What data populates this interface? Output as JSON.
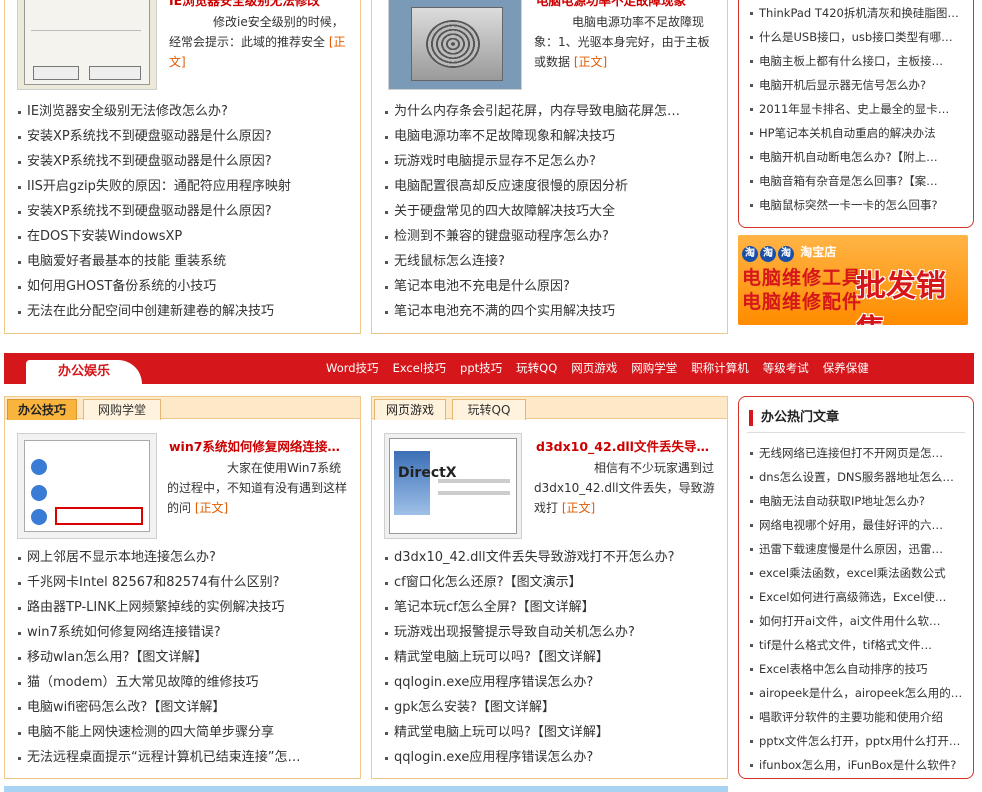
{
  "top_left": {
    "feature_title": "IE浏览器安全级别无法修改",
    "feature_text": "修改ie安全级别的时候，经常会提示：此域的推荐安全",
    "more_label": "[正文]",
    "list": [
      "IE浏览器安全级别无法修改怎么办?",
      "安装XP系统找不到硬盘驱动器是什么原因?",
      "安装XP系统找不到硬盘驱动器是什么原因?",
      "IIS开启gzip失败的原因：通配符应用程序映射",
      "安装XP系统找不到硬盘驱动器是什么原因?",
      "在DOS下安装WindowsXP",
      "电脑爱好者最基本的技能 重装系统",
      "如何用GHOST备份系统的小技巧",
      "无法在此分配空间中创建新建卷的解决技巧"
    ]
  },
  "top_mid": {
    "feature_title": "电脑电源功率不足故障现象",
    "feature_text": "电脑电源功率不足故障现象：1、光驱本身完好，由于主板或数据",
    "more_label": "[正文]",
    "list": [
      "为什么内存条会引起花屏，内存导致电脑花屏怎…",
      "电脑电源功率不足故障现象和解决技巧",
      "玩游戏时电脑提示显存不足怎么办?",
      "电脑配置很高却反应速度很慢的原因分析",
      "关于硬盘常见的四大故障解决技巧大全",
      "检测到不兼容的键盘驱动程序怎么办?",
      "无线鼠标怎么连接?",
      "笔记本电池不充电是什么原因?",
      "笔记本电池充不满的四个实用解决技巧"
    ]
  },
  "top_side": {
    "list": [
      "ThinkPad T420拆机清灰和换硅脂图…",
      "什么是USB接口，usb接口类型有哪…",
      "电脑主板上都有什么接口，主板接…",
      "电脑开机后显示器无信号怎么办?",
      "2011年显卡排名、史上最全的显卡…",
      "HP笔记本关机自动重启的解决办法",
      "电脑开机自动断电怎么办?【附上…",
      "电脑音箱有杂音是怎么回事?【案…",
      "电脑鼠标突然一卡一卡的怎么回事?"
    ]
  },
  "ad": {
    "shop": "淘宝店",
    "line1": "电脑维修工具",
    "line2": "电脑维修配件",
    "big": "批发销售",
    "icon": "taobao-icon"
  },
  "nav_bar": {
    "active_label": "办公娱乐",
    "links": [
      "Word技巧",
      "Excel技巧",
      "ppt技巧",
      "玩转QQ",
      "网页游戏",
      "网购学堂",
      "职称计算机",
      "等级考试",
      "保养保健"
    ],
    "color": "#d5161b"
  },
  "office": {
    "tabs": [
      "办公技巧",
      "网购学堂"
    ],
    "feature_title": "win7系统如何修复网络连接…",
    "feature_text": "大家在使用Win7系统的过程中，不知道有没有遇到这样的问",
    "more_label": "[正文]",
    "list": [
      {
        "text": "网上邻居不显示本地连接怎么办?",
        "extra": ""
      },
      {
        "text": "千兆网卡Intel 82567和82574有什么区别?",
        "extra": ""
      },
      {
        "text": "路由器TP-LINK上网频繁掉线的实例解决技巧",
        "extra": ""
      },
      {
        "text": "win7系统如何修复网络连接错误?",
        "extra": ""
      },
      {
        "text": "移动wlan怎么用?",
        "extra": "【图文详解】"
      },
      {
        "text": "猫（modem）五大常见故障的维修技巧",
        "extra": ""
      },
      {
        "text": "电脑wifi密码怎么改?",
        "extra": "【图文详解】"
      },
      {
        "text": "电脑不能上网快速检测的四大简单步骤分享",
        "extra": ""
      },
      {
        "text": "无法远程桌面提示“远程计算机已结束连接”怎…",
        "extra": ""
      }
    ]
  },
  "games": {
    "tabs": [
      "网页游戏",
      "玩转QQ"
    ],
    "feature_title": "d3dx10_42.dll文件丢失导…",
    "feature_text": "相信有不少玩家遇到过d3dx10_42.dll文件丢失，导致游戏打",
    "more_label": "[正文]",
    "thumb_caption": "DirectX",
    "list": [
      {
        "text": "d3dx10_42.dll文件丢失导致游戏打不开怎么办?",
        "extra": ""
      },
      {
        "text": "cf窗口化怎么还原?",
        "extra": "【图文演示】"
      },
      {
        "text": "笔记本玩cf怎么全屏?",
        "extra": "【图文详解】"
      },
      {
        "text": "玩游戏出现报警提示导致自动关机怎么办?",
        "extra": ""
      },
      {
        "text": "精武堂电脑上玩可以吗?",
        "extra": "【图文详解】"
      },
      {
        "text": "qqlogin.exe应用程序错误怎么办?",
        "extra": ""
      },
      {
        "text": "gpk怎么安装?",
        "extra": "【图文详解】"
      },
      {
        "text": "精武堂电脑上玩可以吗?",
        "extra": "【图文详解】"
      },
      {
        "text": "qqlogin.exe应用程序错误怎么办?",
        "extra": ""
      }
    ]
  },
  "hot": {
    "title": "办公热门文章",
    "list": [
      "无线网络已连接但打不开网页是怎…",
      "dns怎么设置，DNS服务器地址怎么…",
      "电脑无法自动获取IP地址怎么办?",
      "网络电视哪个好用，最佳好评的六…",
      "迅雷下载速度慢是什么原因，迅雷…",
      "excel乘法函数，excel乘法函数公式",
      "Excel如何进行高级筛选，Excel使…",
      "如何打开ai文件，ai文件用什么软…",
      "tif是什么格式文件，tif格式文件…",
      "Excel表格中怎么自动排序的技巧",
      "airopeek是什么，airopeek怎么用的…",
      "唱歌评分软件的主要功能和使用介绍",
      "pptx文件怎么打开，pptx用什么打开…",
      "ifunbox怎么用，iFunBox是什么软件?"
    ]
  }
}
